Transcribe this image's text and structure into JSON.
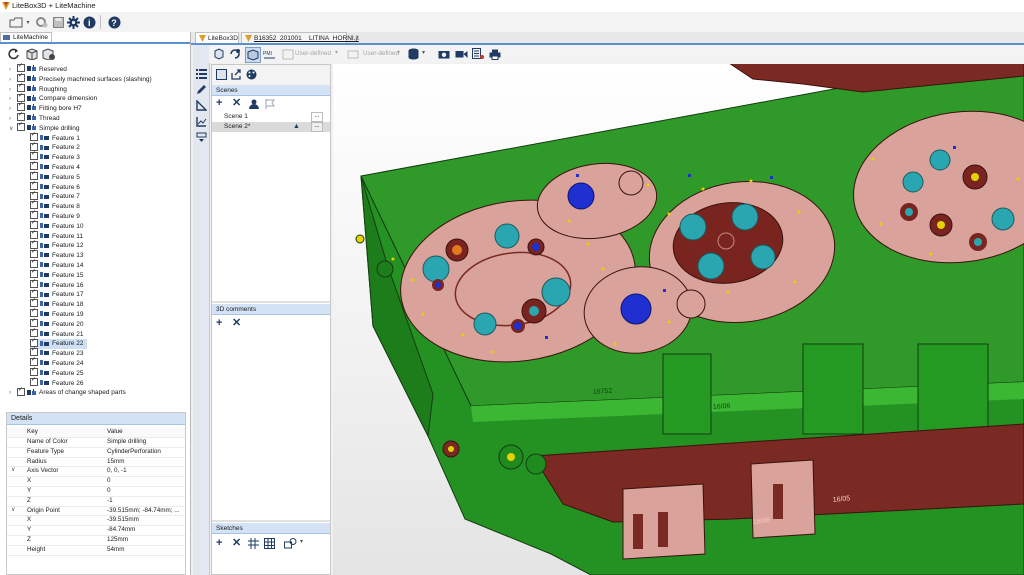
{
  "window": {
    "title": "LiteBox3D + LiteMachine"
  },
  "left_panel": {
    "tab_label": "LiteMachine",
    "tree": [
      {
        "label": "Reserved",
        "level": 0,
        "expanded": false
      },
      {
        "label": "Precisely machined surfaces (slashing)",
        "level": 0,
        "expanded": false
      },
      {
        "label": "Roughing",
        "level": 0,
        "expanded": false
      },
      {
        "label": "Compare dimension",
        "level": 0,
        "expanded": false
      },
      {
        "label": "Fitting bore H7",
        "level": 0,
        "expanded": false
      },
      {
        "label": "Thread",
        "level": 0,
        "expanded": false
      },
      {
        "label": "Simple drilling",
        "level": 0,
        "expanded": true
      },
      {
        "label": "Feature 1",
        "level": 1
      },
      {
        "label": "Feature 2",
        "level": 1
      },
      {
        "label": "Feature 3",
        "level": 1
      },
      {
        "label": "Feature 4",
        "level": 1
      },
      {
        "label": "Feature 5",
        "level": 1
      },
      {
        "label": "Feature 6",
        "level": 1
      },
      {
        "label": "Feature 7",
        "level": 1
      },
      {
        "label": "Feature 8",
        "level": 1
      },
      {
        "label": "Feature 9",
        "level": 1
      },
      {
        "label": "Feature 10",
        "level": 1
      },
      {
        "label": "Feature 11",
        "level": 1
      },
      {
        "label": "Feature 12",
        "level": 1
      },
      {
        "label": "Feature 13",
        "level": 1
      },
      {
        "label": "Feature 14",
        "level": 1
      },
      {
        "label": "Feature 15",
        "level": 1
      },
      {
        "label": "Feature 16",
        "level": 1
      },
      {
        "label": "Feature 17",
        "level": 1
      },
      {
        "label": "Feature 18",
        "level": 1
      },
      {
        "label": "Feature 19",
        "level": 1
      },
      {
        "label": "Feature 20",
        "level": 1
      },
      {
        "label": "Feature 21",
        "level": 1
      },
      {
        "label": "Feature 22",
        "level": 1,
        "selected": true
      },
      {
        "label": "Feature 23",
        "level": 1
      },
      {
        "label": "Feature 24",
        "level": 1
      },
      {
        "label": "Feature 25",
        "level": 1
      },
      {
        "label": "Feature 26",
        "level": 1
      },
      {
        "label": "Areas of change shaped parts",
        "level": 0,
        "expanded": false
      }
    ]
  },
  "details": {
    "title": "Details",
    "header": {
      "key": "Key",
      "value": "Value"
    },
    "rows": [
      {
        "key": "Name of Color",
        "value": "Simple drilling"
      },
      {
        "key": "Feature Type",
        "value": "CylinderPerforation"
      },
      {
        "key": "Radius",
        "value": "15mm"
      },
      {
        "key": "Axis Vector",
        "value": "0, 0, -1",
        "expander": "∨"
      },
      {
        "key": "X",
        "value": "0"
      },
      {
        "key": "Y",
        "value": "0"
      },
      {
        "key": "Z",
        "value": "-1"
      },
      {
        "key": "Origin Point",
        "value": "-39.515mm; -84.74mm; ...",
        "expander": "∨"
      },
      {
        "key": "X",
        "value": "-39.515mm"
      },
      {
        "key": "Y",
        "value": "-84.74mm"
      },
      {
        "key": "Z",
        "value": "125mm"
      },
      {
        "key": "Height",
        "value": "54mm"
      }
    ]
  },
  "tabs": [
    {
      "label": "LiteBox3D"
    },
    {
      "label": "B16352_201001__LITINA_HORNI.jt"
    }
  ],
  "view_toolbar": {
    "preset1": "User-defined",
    "preset2": "User-defined"
  },
  "scenes_panel": {
    "title": "Scenes",
    "scenes": [
      {
        "label": "Scene 1",
        "button": "..."
      },
      {
        "label": "Scene 2*",
        "button": "..."
      }
    ],
    "comments_title": "3D comments",
    "sketches_title": "Sketches"
  },
  "engraving": {
    "a": "16/06",
    "b": "16752",
    "c": "16/05",
    "d": "16/06"
  },
  "colors": {
    "accent": "#5a8fd0",
    "panel_header": "#d3e2f5",
    "model_green": "#2f9a2a",
    "model_face": "#d9a29a",
    "hole_cyan": "#2aa6b0",
    "hole_blue": "#1f2fd0",
    "hole_red": "#7a2420"
  }
}
